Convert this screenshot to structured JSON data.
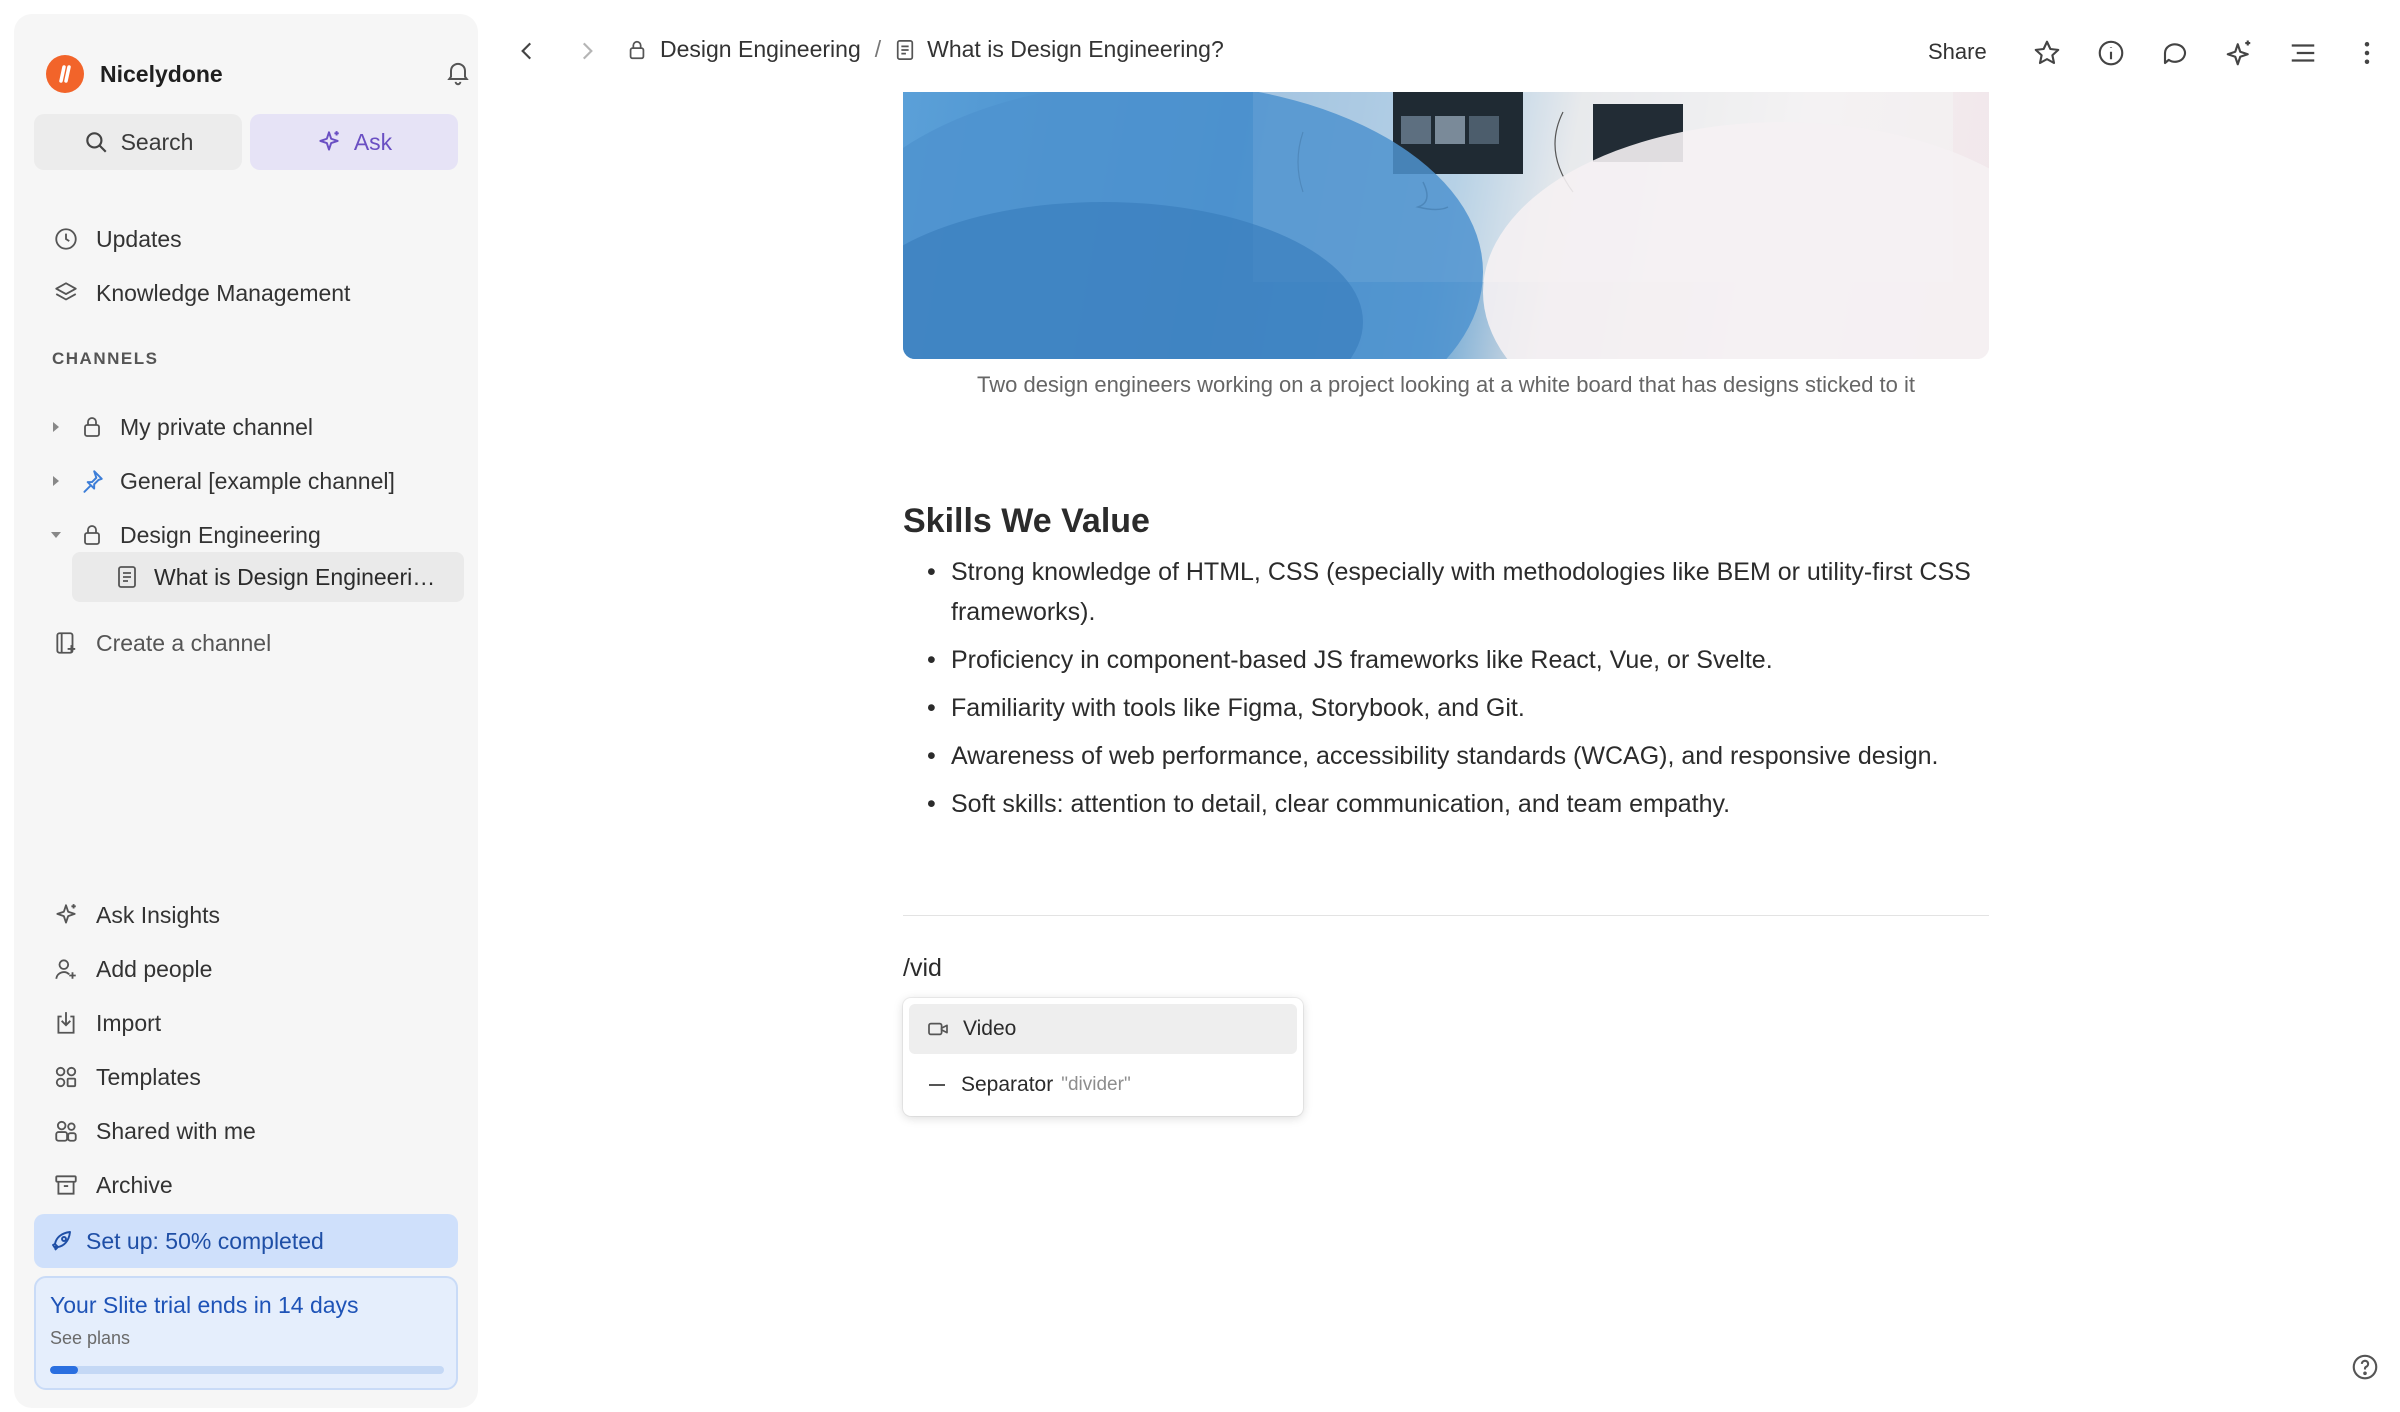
{
  "sidebar": {
    "workspace_name": "Nicelydone",
    "search_label": "Search",
    "ask_label": "Ask",
    "nav_items": [
      {
        "label": "Updates",
        "icon": "clock-icon"
      },
      {
        "label": "Knowledge Management",
        "icon": "layers-icon"
      }
    ],
    "channels_heading": "CHANNELS",
    "channels": [
      {
        "label": "My private channel",
        "icon": "lock-icon",
        "expanded": false
      },
      {
        "label": "General [example channel]",
        "icon": "pin-icon",
        "expanded": false
      },
      {
        "label": "Design Engineering",
        "icon": "lock-icon",
        "expanded": true
      }
    ],
    "active_page": "What is Design Engineering?",
    "create_channel_label": "Create a channel",
    "bottom_items": [
      {
        "label": "Ask Insights",
        "icon": "sparkle-icon"
      },
      {
        "label": "Add people",
        "icon": "add-user-icon"
      },
      {
        "label": "Import",
        "icon": "import-icon"
      },
      {
        "label": "Templates",
        "icon": "templates-icon"
      },
      {
        "label": "Shared with me",
        "icon": "people-icon"
      },
      {
        "label": "Archive",
        "icon": "archive-icon"
      }
    ],
    "setup_label": "Set up: 50% completed",
    "trial_title": "Your Slite trial ends in 14 days",
    "trial_link": "See plans",
    "trial_progress": 0.07
  },
  "topbar": {
    "breadcrumb_channel": "Design Engineering",
    "breadcrumb_separator": "/",
    "breadcrumb_page": "What is Design Engineering?",
    "share_label": "Share"
  },
  "document": {
    "image_caption": "Two design engineers working on a project looking at a white board that has designs sticked to it",
    "heading": "Skills We Value",
    "bullets": [
      "Strong knowledge of HTML, CSS (especially with methodologies like BEM or utility-first CSS frameworks).",
      "Proficiency in component-based JS frameworks like React, Vue, or Svelte.",
      "Familiarity with tools like Figma, Storybook, and Git.",
      "Awareness of web performance, accessibility standards (WCAG), and responsive design.",
      "Soft skills: attention to detail, clear communication, and team empathy."
    ],
    "command_text": "/vid"
  },
  "command_menu": {
    "items": [
      {
        "label": "Video",
        "hint": "",
        "icon": "video-icon"
      },
      {
        "label": "Separator",
        "hint": "\"divider\"",
        "icon": "minus-icon"
      }
    ]
  },
  "colors": {
    "accent": "#6a4fc3",
    "brand": "#f2642a",
    "setup_bg": "#cfe0fb",
    "link_blue": "#1e53b7"
  }
}
